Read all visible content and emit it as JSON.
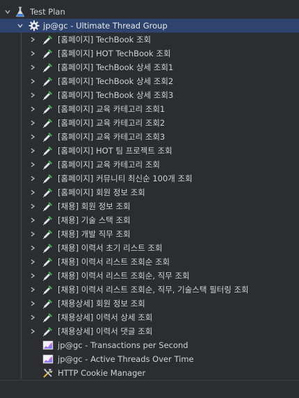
{
  "colors": {
    "background": "#2b2d30",
    "selection": "#2e436e",
    "text": "#cfd3d8",
    "sampler_icon_handle": "#4caf50"
  },
  "tree": {
    "test_plan": {
      "label": "Test Plan",
      "icon": "flask-icon",
      "expanded": true
    },
    "thread_group": {
      "label": "jp@gc - Ultimate Thread Group",
      "icon": "gear-icon",
      "expanded": true,
      "selected": true
    },
    "samplers": [
      {
        "label": "[홈페이지] TechBook 조회"
      },
      {
        "label": "[홈페이지] HOT TechBook 조회"
      },
      {
        "label": "[홈페이지] TechBook 상세 조회1"
      },
      {
        "label": "[홈페이지] TechBook 상세 조회2"
      },
      {
        "label": "[홈페이지] TechBook 상세 조회3"
      },
      {
        "label": "[홈페이지] 교육 카테고리 조회1"
      },
      {
        "label": "[홈페이지] 교육 카테고리 조회2"
      },
      {
        "label": "[홈페이지] 교육 카테고리 조회3"
      },
      {
        "label": "[홈페이지] HOT 팀 프로젝트 조회"
      },
      {
        "label": "[홈페이지] 교육 카테고리 조회"
      },
      {
        "label": "[홈페이지] 커뮤니티 최신순 100개 조회"
      },
      {
        "label": "[홈페이지] 회원 정보 조회"
      },
      {
        "label": "[채용] 회원 정보 조회"
      },
      {
        "label": "[채용] 기술 스택 조회"
      },
      {
        "label": "[채용] 개발 직무 조회"
      },
      {
        "label": "[채용] 이력서 초기 리스트 조회"
      },
      {
        "label": "[채용] 이력서 리스트 조회순 조회"
      },
      {
        "label": "[채용] 이력서 리스트 조회순, 직무 조회"
      },
      {
        "label": "[채용] 이력서 리스트 조회순, 직무, 기술스택 필터링 조회"
      },
      {
        "label": "[채용상세] 회원 정보 조회"
      },
      {
        "label": "[채용상세] 이력서 상세 조회"
      },
      {
        "label": "[채용상세] 이력서 댓글 조회"
      }
    ],
    "listeners": [
      {
        "label": "jp@gc - Transactions per Second",
        "icon": "graph-icon"
      },
      {
        "label": "jp@gc - Active Threads Over Time",
        "icon": "graph-icon"
      },
      {
        "label": "HTTP Cookie Manager",
        "icon": "tools-icon"
      }
    ]
  }
}
